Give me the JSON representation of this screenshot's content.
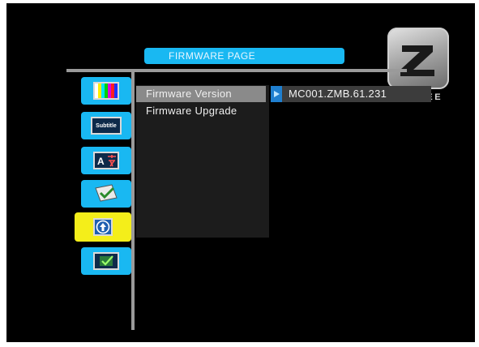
{
  "header": {
    "title": "FIRMWARE PAGE"
  },
  "brand": {
    "logo_letter": "Z",
    "logo_text": "ZOMBEE"
  },
  "menu": {
    "items": [
      {
        "label": "Firmware Version",
        "selected": true
      },
      {
        "label": "Firmware Upgrade",
        "selected": false
      }
    ]
  },
  "detail": {
    "value": "MC001.ZMB.61.231"
  },
  "sidebar": {
    "items": [
      {
        "icon": "tv-color-bars-icon",
        "active": false
      },
      {
        "icon": "subtitle-icon",
        "label": "Subtitle",
        "active": false
      },
      {
        "icon": "language-icon",
        "label": "A",
        "active": false
      },
      {
        "icon": "checklist-icon",
        "active": false
      },
      {
        "icon": "firmware-upgrade-icon",
        "active": true
      },
      {
        "icon": "settings-check-icon",
        "active": false
      }
    ]
  },
  "colors": {
    "accent": "#19b8f2",
    "active": "#f4ee1a",
    "frame": "#9a9a9a",
    "panel": "#1c1c1c",
    "selection": "#8a8a8a"
  }
}
